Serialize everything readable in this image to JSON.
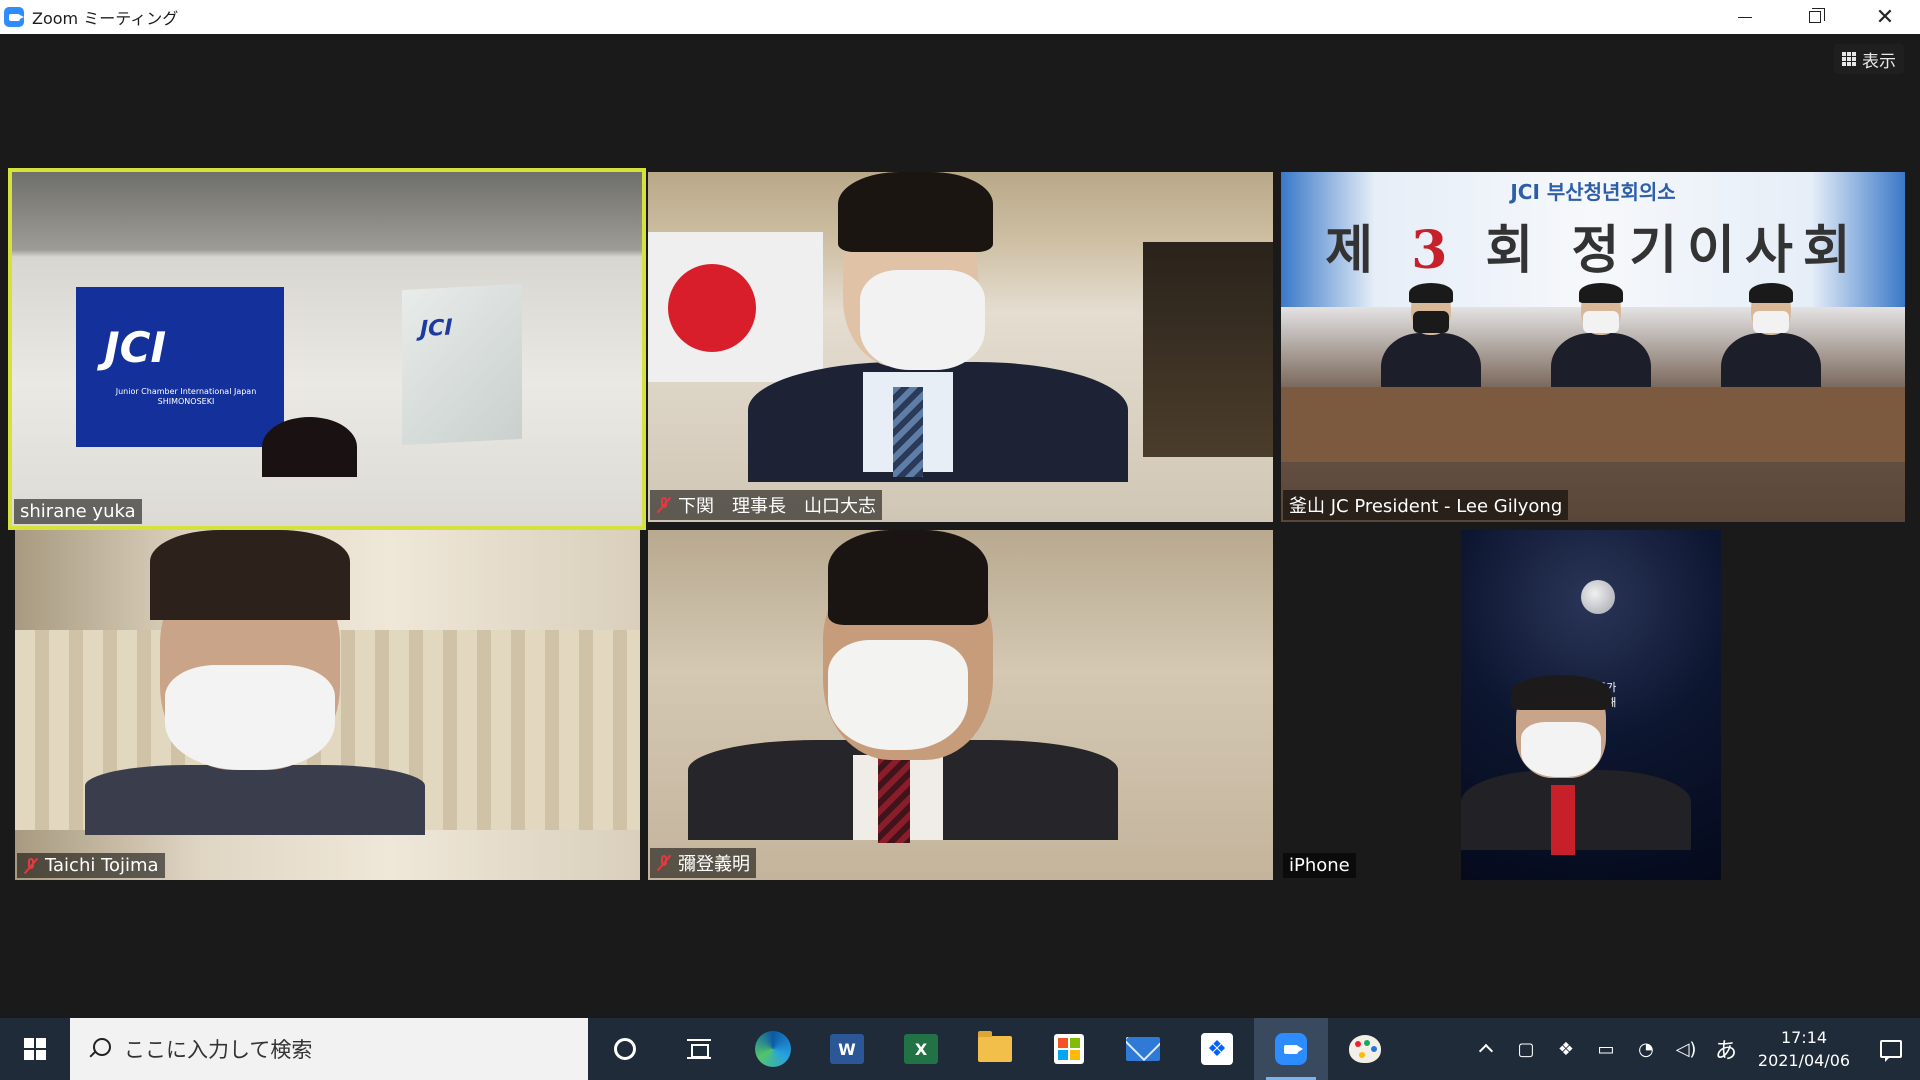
{
  "window": {
    "title": "Zoom ミーティング",
    "min_symbol": "",
    "close_symbol": "✕"
  },
  "meeting": {
    "view_label": "表示",
    "participants": [
      {
        "name": "shirane yuka",
        "muted": false,
        "active_speaker": true
      },
      {
        "name": "下関　理事長　山口大志",
        "muted": true,
        "active_speaker": false
      },
      {
        "name": "釜山 JC President -  Lee Gilyong",
        "muted": false,
        "active_speaker": false
      },
      {
        "name": "Taichi Tojima",
        "muted": true,
        "active_speaker": false
      },
      {
        "name": "彌登義明",
        "muted": true,
        "active_speaker": false
      },
      {
        "name": "iPhone",
        "muted": false,
        "active_speaker": false
      }
    ],
    "scene_text": {
      "jci_logo": "JCI",
      "jci_sub": "Junior Chamber International Japan SHIMONOSEKI",
      "plaque_logo": "JCI",
      "banner_line1": "JCI 부산청년회의소",
      "banner_prefix": "제 ",
      "banner_number": "3",
      "banner_suffix": " 회 정기이사회",
      "space_text": "우주가\n응원해"
    },
    "active_speaker_color": "#d6e23a",
    "mute_color": "#e5393f"
  },
  "taskbar": {
    "search_placeholder": "ここに入力して検索",
    "apps": [
      {
        "icon": "cortana-icon"
      },
      {
        "icon": "task-view-icon"
      },
      {
        "icon": "edge-icon"
      },
      {
        "icon": "word-icon",
        "glyph": "W"
      },
      {
        "icon": "excel-icon",
        "glyph": "X"
      },
      {
        "icon": "file-explorer-icon"
      },
      {
        "icon": "store-icon"
      },
      {
        "icon": "mail-icon"
      },
      {
        "icon": "dropbox-icon",
        "glyph": "❖"
      },
      {
        "icon": "zoom-icon",
        "active": true
      },
      {
        "icon": "paint-icon"
      }
    ],
    "tray": {
      "ime_label": "あ",
      "time": "17:14",
      "date": "2021/04/06"
    },
    "background_color": "#1f2b38"
  }
}
